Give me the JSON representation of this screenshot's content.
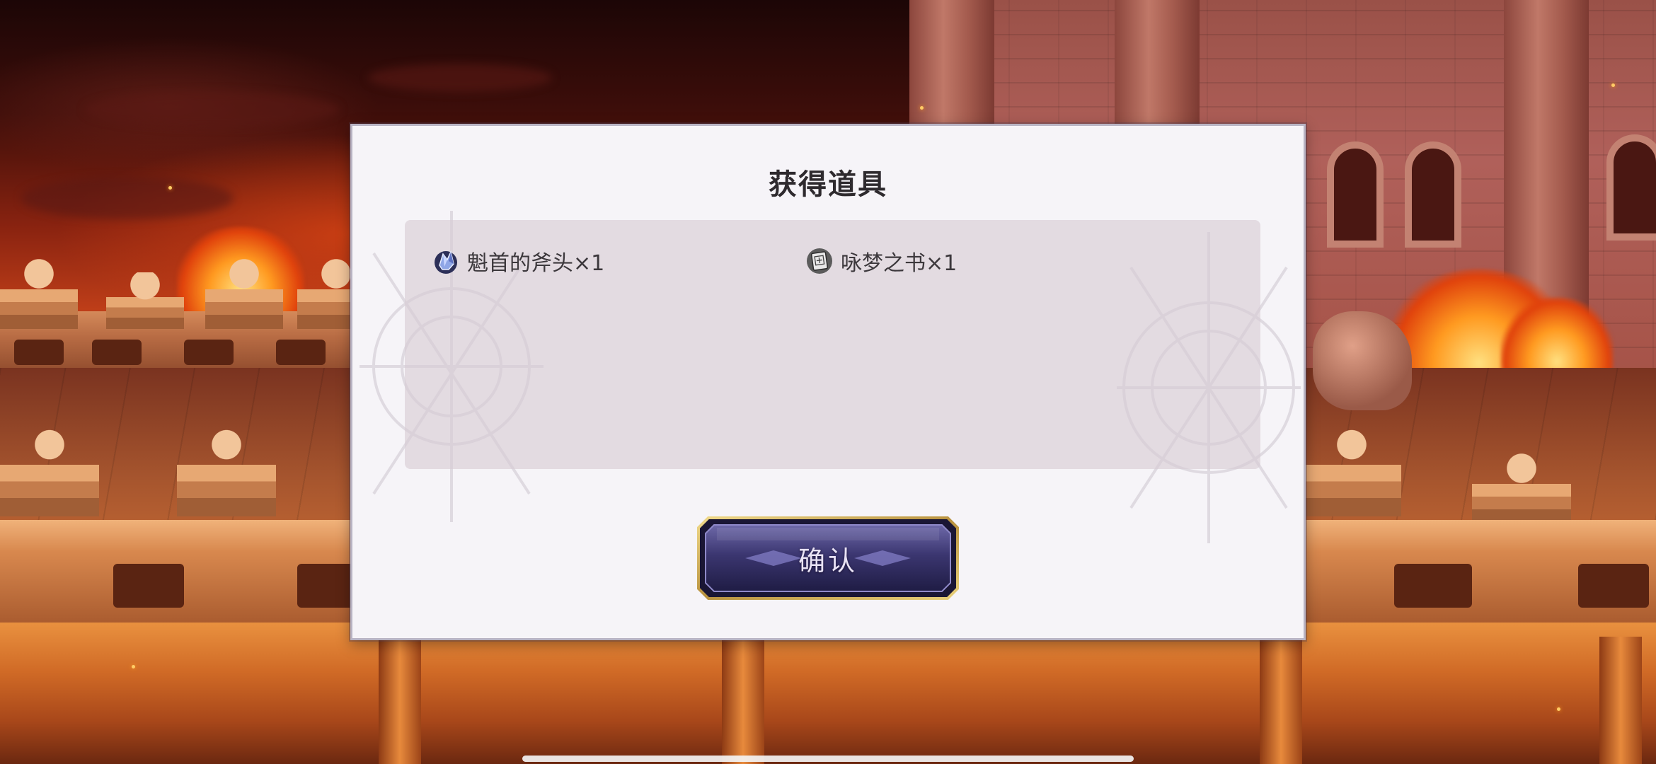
{
  "dialog": {
    "title": "获得道具",
    "confirm_label": "确认"
  },
  "items": [
    {
      "name": "魁首的斧头×1",
      "icon": "crystal-ore-icon"
    },
    {
      "name": "咏梦之书×1",
      "icon": "book-icon"
    }
  ],
  "colors": {
    "dialog_bg": "#f6f4f8",
    "panel_bg": "#dcd3da",
    "button_fill": "#3b3670",
    "button_border": "#c9a85a"
  }
}
